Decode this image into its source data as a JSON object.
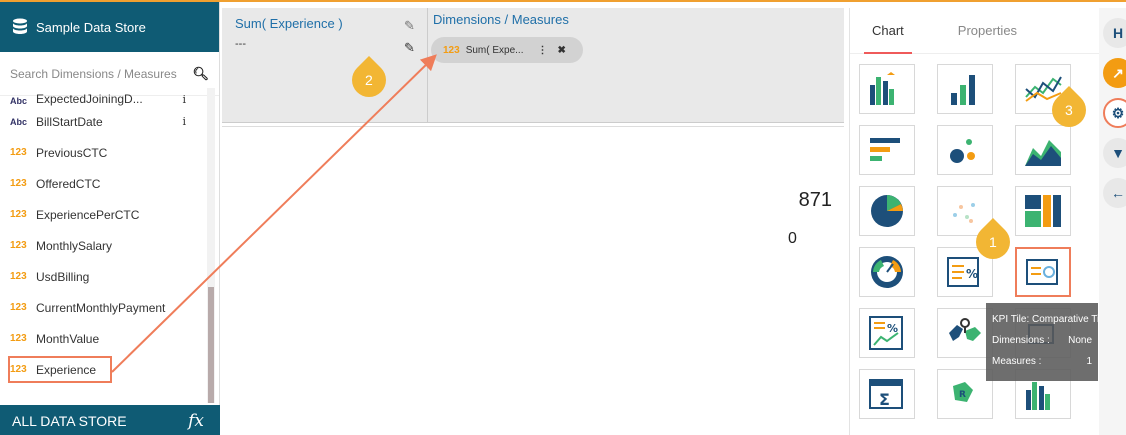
{
  "datastore": {
    "title": "Sample Data Store",
    "search_placeholder": "Search Dimensions / Measures",
    "footer_label": "ALL DATA STORE",
    "footer_icon": "fx"
  },
  "fields": [
    {
      "type": "Abc",
      "name": "ExpectedJoiningD...",
      "info": "i"
    },
    {
      "type": "Abc",
      "name": "BillStartDate",
      "info": "i"
    },
    {
      "type": "123",
      "name": "PreviousCTC"
    },
    {
      "type": "123",
      "name": "OfferedCTC"
    },
    {
      "type": "123",
      "name": "ExperiencePerCTC"
    },
    {
      "type": "123",
      "name": "MonthlySalary"
    },
    {
      "type": "123",
      "name": "UsdBilling"
    },
    {
      "type": "123",
      "name": "CurrentMonthlyPayment"
    },
    {
      "type": "123",
      "name": "MonthValue"
    },
    {
      "type": "123",
      "name": "Experience"
    }
  ],
  "drop": {
    "measure_title": "Sum( Experience )",
    "measure_value": "---",
    "dm_title": "Dimensions / Measures",
    "chip_type": "123",
    "chip_label": "Sum( Expe..."
  },
  "canvas": {
    "kpi_value": "871",
    "kpi_sub": "0"
  },
  "right": {
    "tabs": [
      "Chart",
      "Properties"
    ],
    "tooltip": {
      "title": "KPI Tile: Comparative Tile",
      "dim_label": "Dimensions :",
      "dim_value": "None",
      "meas_label": "Measures :",
      "meas_value": "1"
    }
  },
  "callouts": [
    "1",
    "2",
    "3"
  ],
  "colors": {
    "header": "#0f5b74",
    "accent": "#f39c12",
    "highlight": "#ef7d5a",
    "callout": "#f2b634"
  }
}
